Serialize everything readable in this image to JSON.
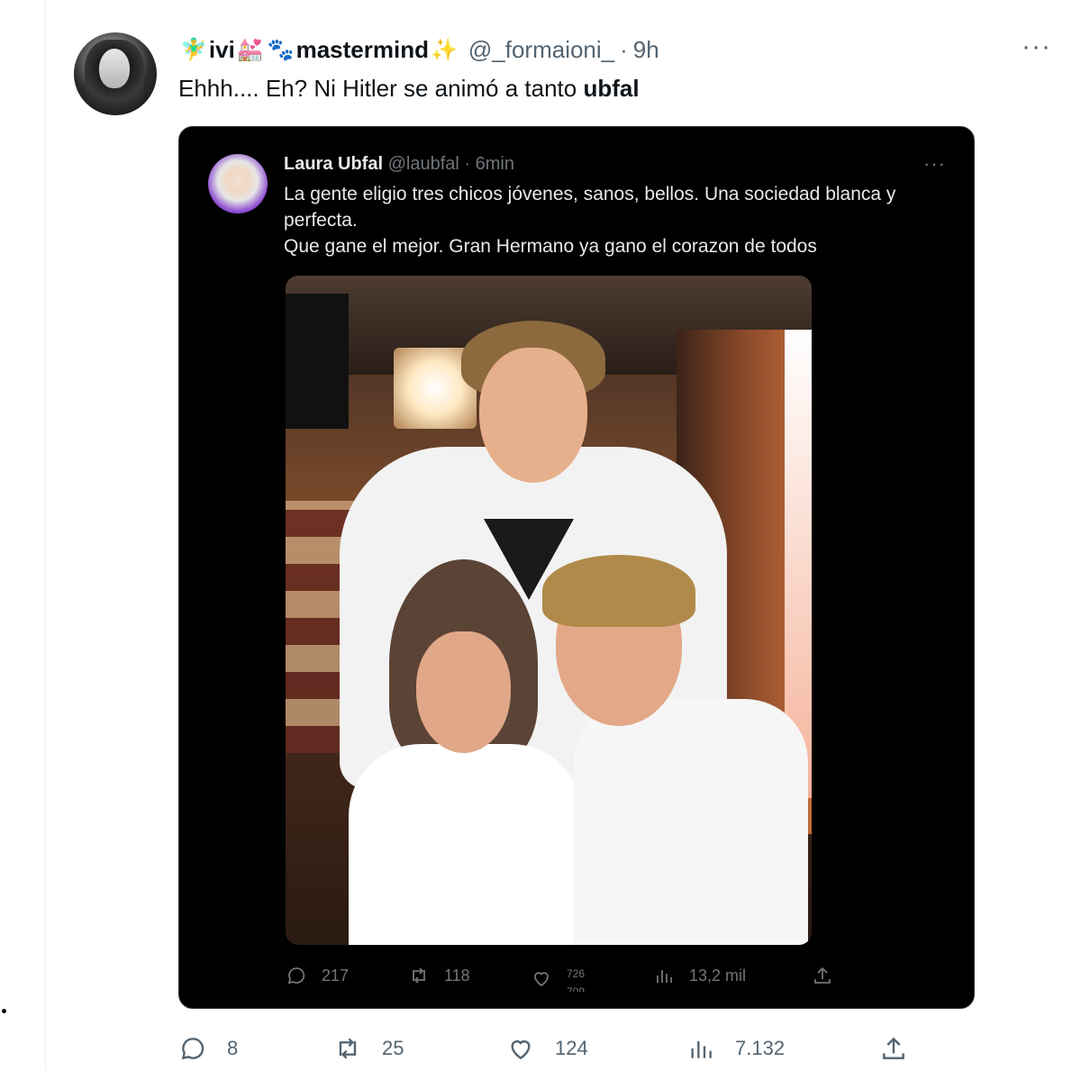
{
  "tweet": {
    "display_name": "ivi",
    "display_name_suffix": "mastermind",
    "emojis": [
      "🧚‍♂️",
      "💒",
      "🐾",
      "✨"
    ],
    "handle": "@_formaioni_",
    "separator": "·",
    "time": "9h",
    "text_before": "Ehhh.... Eh? Ni Hitler se animó a tanto ",
    "text_bold": "ubfal",
    "actions": {
      "replies": "8",
      "retweets": "25",
      "likes": "124",
      "views": "7.132"
    }
  },
  "quoted": {
    "display_name": "Laura Ubfal",
    "handle": "@laubfal",
    "separator": "·",
    "time": "6min",
    "text_line1": "La gente eligio tres chicos jóvenes, sanos, bellos. Una sociedad blanca y perfecta.",
    "text_line2": "Que gane el mejor. Gran Hermano ya gano el corazon de todos",
    "actions": {
      "replies": "217",
      "retweets": "118",
      "likes_rolling": "726",
      "likes_rolling_next": "709",
      "views": "13,2 mil"
    }
  },
  "colors": {
    "accent": "#1d9bf0",
    "text_primary": "#0f1419",
    "text_secondary": "#536471",
    "embed_bg": "#000000"
  },
  "icons": [
    "more-icon",
    "reply-icon",
    "retweet-icon",
    "like-icon",
    "views-icon",
    "share-icon"
  ]
}
